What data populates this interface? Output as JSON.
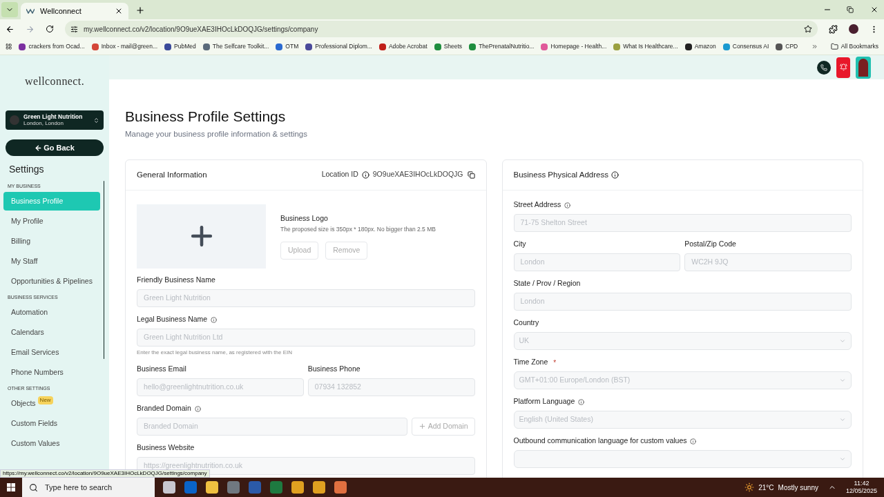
{
  "browser": {
    "tab_title": "Wellconnect",
    "url": "my.wellconnect.co/v2/location/9O9ueXAE3IHOcLkDOQJG/settings/company",
    "bookmarks": [
      {
        "label": "crackers from Ocad..."
      },
      {
        "label": "Inbox - mail@green..."
      },
      {
        "label": "PubMed"
      },
      {
        "label": "The Selfcare Toolkit..."
      },
      {
        "label": "OTM"
      },
      {
        "label": "Professional Diplom..."
      },
      {
        "label": "Adobe Acrobat"
      },
      {
        "label": "Sheets"
      },
      {
        "label": "ThePrenatalNutritio..."
      },
      {
        "label": "Homepage - Health..."
      },
      {
        "label": "What Is Healthcare..."
      },
      {
        "label": "Amazon"
      },
      {
        "label": "Consensus AI"
      },
      {
        "label": "CPD"
      }
    ],
    "all_bookmarks": "All Bookmarks",
    "status_url": "https://my.wellconnect.co/v2/location/9O9ueXAE3IHOcLkDOQJG/settings/company"
  },
  "sidebar": {
    "logo": "wellconnect.",
    "account": {
      "name": "Green Light Nutrition",
      "location": "London, London"
    },
    "go_back": "Go Back",
    "heading": "Settings",
    "sections": [
      {
        "title": "MY BUSINESS",
        "items": [
          {
            "label": "Business Profile",
            "selected": true
          },
          {
            "label": "My Profile",
            "selected": false
          },
          {
            "label": "Billing",
            "selected": false
          },
          {
            "label": "My Staff",
            "selected": false
          },
          {
            "label": "Opportunities & Pipelines",
            "selected": false
          }
        ]
      },
      {
        "title": "BUSINESS SERVICES",
        "items": [
          {
            "label": "Automation",
            "selected": false
          },
          {
            "label": "Calendars",
            "selected": false
          },
          {
            "label": "Email Services",
            "selected": false
          },
          {
            "label": "Phone Numbers",
            "selected": false
          }
        ]
      },
      {
        "title": "OTHER SETTINGS",
        "items": [
          {
            "label": "Objects",
            "selected": false,
            "badge": "New"
          },
          {
            "label": "Custom Fields",
            "selected": false
          },
          {
            "label": "Custom Values",
            "selected": false
          }
        ]
      }
    ]
  },
  "page": {
    "title": "Business Profile Settings",
    "subtitle": "Manage your business profile information & settings"
  },
  "general": {
    "title": "General Information",
    "location_id_label": "Location ID",
    "location_id": "9O9ueXAE3IHOcLkDOQJG",
    "logo": {
      "label": "Business Logo",
      "hint": "The proposed size is 350px * 180px. No bigger than 2.5 MB",
      "buttons": [
        "Upload",
        "Remove"
      ]
    },
    "rows": [
      [
        {
          "kind": "text",
          "label": "Friendly Business Name",
          "value": "Green Light Nutrition",
          "info": false,
          "disabled": true
        }
      ],
      [
        {
          "kind": "text",
          "label": "Legal Business Name",
          "value": "Green Light Nutrition Ltd",
          "info": true,
          "disabled": true,
          "hint": "Enter the exact legal business name, as registered with the EIN"
        }
      ],
      [
        {
          "kind": "text",
          "label": "Business Email",
          "value": "hello@greenlightnutrition.co.uk",
          "info": false,
          "disabled": true
        },
        {
          "kind": "text",
          "label": "Business Phone",
          "value": "07934 132852",
          "info": false,
          "disabled": true
        }
      ],
      [
        {
          "kind": "text",
          "label": "Branded Domain",
          "placeholder": "Branded Domain",
          "info": true,
          "disabled": true,
          "action": "Add Domain"
        }
      ],
      [
        {
          "kind": "text",
          "label": "Business Website",
          "value": "https://greenlightnutrition.co.uk",
          "info": false,
          "disabled": true
        }
      ]
    ]
  },
  "address": {
    "title": "Business Physical Address",
    "rows": [
      [
        {
          "kind": "text",
          "label": "Street Address",
          "value": "71-75 Shelton Street",
          "info": true,
          "disabled": true
        }
      ],
      [
        {
          "kind": "text",
          "label": "City",
          "value": "London",
          "info": false,
          "disabled": true
        },
        {
          "kind": "text",
          "label": "Postal/Zip Code",
          "value": "WC2H 9JQ",
          "info": false,
          "disabled": true
        }
      ],
      [
        {
          "kind": "text",
          "label": "State / Prov / Region",
          "value": "London",
          "info": false,
          "disabled": true
        }
      ],
      [
        {
          "kind": "select",
          "label": "Country",
          "value": "UK",
          "info": false,
          "disabled": true
        }
      ],
      [
        {
          "kind": "select",
          "label": "Time Zone",
          "value": "GMT+01:00 Europe/London (BST)",
          "info": false,
          "disabled": true,
          "required_mark": "*"
        }
      ],
      [
        {
          "kind": "select",
          "label": "Platform Language",
          "value": "English (United States)",
          "info": true,
          "disabled": true
        }
      ],
      [
        {
          "kind": "select",
          "label": "Outbound communication language for custom values",
          "info": true,
          "disabled": true
        }
      ]
    ]
  },
  "taskbar": {
    "search_placeholder": "Type here to search",
    "temperature": "21°C",
    "weather": "Mostly sunny",
    "time": "11:42",
    "date": "12/05/2025"
  }
}
